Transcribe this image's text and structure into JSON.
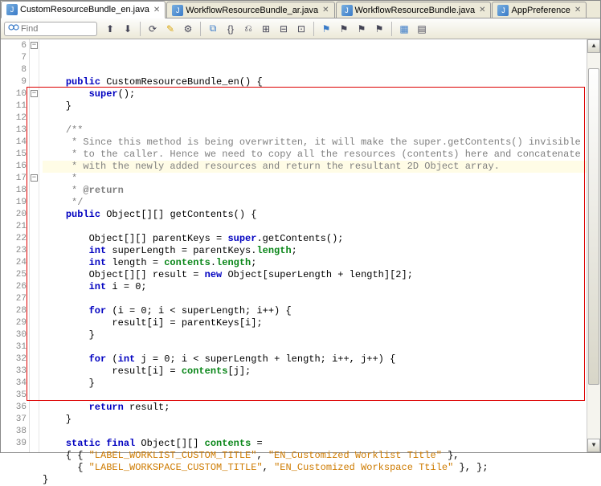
{
  "tabs": [
    {
      "label": "CustomResourceBundle_en.java",
      "active": true
    },
    {
      "label": "WorkflowResourceBundle_ar.java",
      "active": false
    },
    {
      "label": "WorkflowResourceBundle.java",
      "active": false
    },
    {
      "label": "AppPreference",
      "active": false
    }
  ],
  "find": {
    "placeholder": "Find"
  },
  "gutter": {
    "start": 6,
    "end": 39
  },
  "fold_marks": [
    {
      "line": 6,
      "symbol": "−"
    },
    {
      "line": 10,
      "symbol": "−"
    },
    {
      "line": 17,
      "symbol": "−"
    }
  ],
  "code_lines": [
    {
      "n": 6,
      "html": "    <span class='kw'>public</span> CustomResourceBundle_en() {"
    },
    {
      "n": 7,
      "html": "        <span class='kw'>super</span>();"
    },
    {
      "n": 8,
      "html": "    }"
    },
    {
      "n": 9,
      "html": ""
    },
    {
      "n": 10,
      "html": "    <span class='doc'>/**</span>"
    },
    {
      "n": 11,
      "html": "    <span class='doc'> * Since this method is being overwritten, it will make the super.getContents() invisible</span>"
    },
    {
      "n": 12,
      "html": "    <span class='doc'> * to the caller. Hence we need to copy all the resources (contents) here and concatenate</span>"
    },
    {
      "n": 13,
      "html": "    <span class='doc'> * with the newly added resources and return the resultant 2D Object array.</span>",
      "hl": true
    },
    {
      "n": 14,
      "html": "    <span class='doc'> *</span>"
    },
    {
      "n": 15,
      "html": "    <span class='doc'> * </span><span class='docbold'>@return</span>"
    },
    {
      "n": 16,
      "html": "    <span class='doc'> */</span>"
    },
    {
      "n": 17,
      "html": "    <span class='kw'>public</span> Object[][] getContents() {"
    },
    {
      "n": 18,
      "html": ""
    },
    {
      "n": 19,
      "html": "        Object[][] parentKeys = <span class='kw'>super</span>.getContents();"
    },
    {
      "n": 20,
      "html": "        <span class='kw'>int</span> superLength = parentKeys.<span class='fieldref'>length</span>;"
    },
    {
      "n": 21,
      "html": "        <span class='kw'>int</span> length = <span class='fieldref'>contents</span>.<span class='fieldref'>length</span>;"
    },
    {
      "n": 22,
      "html": "        Object[][] result = <span class='kw'>new</span> Object[superLength + length][2];"
    },
    {
      "n": 23,
      "html": "        <span class='kw'>int</span> i = 0;"
    },
    {
      "n": 24,
      "html": ""
    },
    {
      "n": 25,
      "html": "        <span class='kw'>for</span> (i = 0; i &lt; superLength; i++) {"
    },
    {
      "n": 26,
      "html": "            result[i] = parentKeys[i];"
    },
    {
      "n": 27,
      "html": "        }"
    },
    {
      "n": 28,
      "html": ""
    },
    {
      "n": 29,
      "html": "        <span class='kw'>for</span> (<span class='kw'>int</span> j = 0; i &lt; superLength + length; i++, j++) {"
    },
    {
      "n": 30,
      "html": "            result[i] = <span class='fieldref'>contents</span>[j];"
    },
    {
      "n": 31,
      "html": "        }"
    },
    {
      "n": 32,
      "html": ""
    },
    {
      "n": 33,
      "html": "        <span class='kw'>return</span> result;"
    },
    {
      "n": 34,
      "html": "    }"
    },
    {
      "n": 35,
      "html": ""
    },
    {
      "n": 36,
      "html": "    <span class='kw'>static final</span> Object[][] <span class='fieldref'>contents</span> ="
    },
    {
      "n": 37,
      "html": "    { { <span class='str'>\"LABEL_WORKLIST_CUSTOM_TITLE\"</span>, <span class='str'>\"EN_Customized Worklist Title\"</span> },"
    },
    {
      "n": 38,
      "html": "      { <span class='str'>\"LABEL_WORKSPACE_CUSTOM_TITLE\"</span>, <span class='str'>\"EN_Customized Workspace Ttile\"</span> }, };"
    },
    {
      "n": 39,
      "html": "}"
    }
  ],
  "redbox": {
    "top_line": 10,
    "bottom_line": 35
  },
  "scrollbar": {
    "thumb_top_pct": 4,
    "thumb_height_pct": 82
  }
}
